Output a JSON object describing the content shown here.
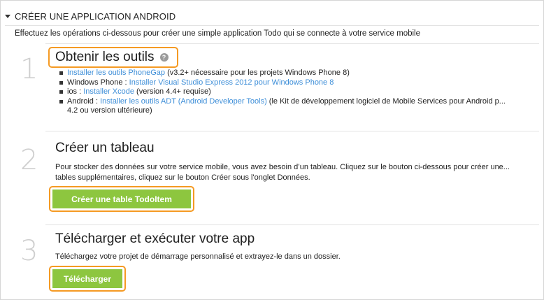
{
  "header": {
    "title": "CRÉER UNE APPLICATION ANDROID"
  },
  "intro": "Effectuez les opérations ci-dessous pour créer une simple application Todo qui se connecte à votre service mobile",
  "steps": [
    {
      "number": "1",
      "title": "Obtenir les outils",
      "help_icon": "?",
      "items": [
        {
          "prefix": "",
          "link": "Installer les outils PhoneGap",
          "suffix": " (v3.2+ nécessaire pour les projets Windows Phone 8)"
        },
        {
          "prefix": "Windows Phone : ",
          "link": "Installer Visual Studio Express 2012 pour Windows Phone 8",
          "suffix": ""
        },
        {
          "prefix": "ios : ",
          "link": "Installer Xcode",
          "suffix": " (version 4.4+ requise)"
        },
        {
          "prefix": "Android : ",
          "link": "Installer les outils ADT (Android Developer Tools)",
          "suffix": " (le Kit de développement logiciel de Mobile Services pour Android p...",
          "suffix2": "4.2 ou version ultérieure)"
        }
      ]
    },
    {
      "number": "2",
      "title": "Créer un tableau",
      "text_line1": "Pour stocker des données sur votre service mobile, vous avez besoin d’un tableau. Cliquez sur le bouton ci-dessous pour créer une...",
      "text_line2": "tables supplémentaires, cliquez sur le bouton Créer sous l'onglet Données.",
      "button": "Créer une table TodoItem"
    },
    {
      "number": "3",
      "title": "Télécharger et exécuter votre app",
      "text": "Téléchargez votre projet de démarrage personnalisé et extrayez-le dans un dossier.",
      "button": "Télécharger"
    }
  ],
  "colors": {
    "accent_green": "#8dc63f",
    "highlight_orange": "#f59a23",
    "link_blue": "#3d8ed8"
  },
  "icons": {
    "collapse": "triangle-down-icon",
    "help": "help-circle-icon"
  }
}
